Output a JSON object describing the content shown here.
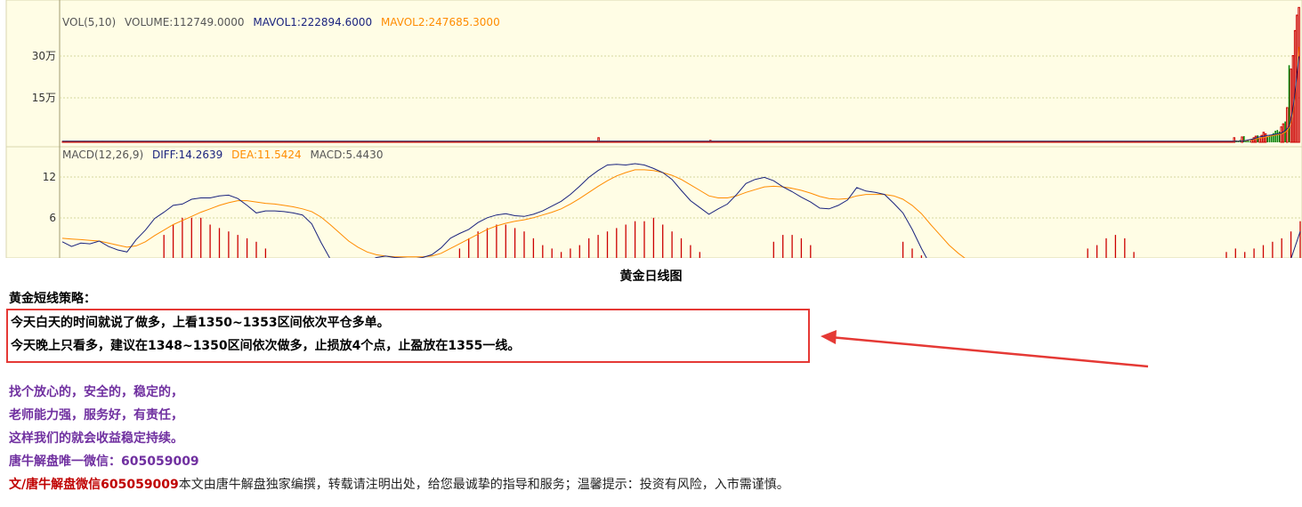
{
  "chart_data": [
    {
      "type": "bar",
      "title": "",
      "legend": [
        {
          "text": "VOL(5,10)",
          "color": "#555555"
        },
        {
          "text": "VOLUME:112749.0000",
          "color": "#555555"
        },
        {
          "text": "MAVOL1:222894.6000",
          "color": "#1a237e"
        },
        {
          "text": "MAVOL2:247685.3000",
          "color": "#ff8c00"
        }
      ],
      "ytick_labels": [
        "30万",
        "15万"
      ],
      "ytick_values": [
        300000,
        150000
      ],
      "ylim": [
        0,
        360000
      ],
      "up_color": "#cc0000",
      "down_color": "#008000",
      "volumes": [
        2000,
        1500,
        2500,
        1800,
        2200,
        1700,
        2100,
        1900,
        2300,
        1600,
        2000,
        2400,
        1800,
        2200,
        1900,
        2100,
        1700,
        2300,
        2000,
        1800,
        2500,
        2200,
        1900,
        2100,
        1800,
        2300,
        2000,
        1700,
        2200,
        2400,
        1900,
        2100,
        1800,
        2000,
        2200,
        1900,
        2300,
        1700,
        2100,
        2000,
        1800,
        2200,
        1900,
        2100,
        2300,
        2000,
        1800,
        2200,
        1900,
        2100,
        2000,
        1700,
        2300,
        2200,
        1900,
        2100,
        1800,
        2000,
        2200,
        1900,
        2100,
        2000,
        1800,
        2200,
        1900,
        2300,
        2100,
        1800,
        2000,
        2200,
        1900,
        2100,
        2000,
        1800,
        2300,
        2200,
        1900,
        2100,
        1800,
        2000,
        2200,
        1900,
        2100,
        2300,
        2000,
        1800,
        2200,
        1900,
        2100,
        2000,
        1800,
        2200,
        1900,
        2300,
        2100,
        1800,
        2000,
        2200,
        1900,
        2100,
        2000,
        1800,
        2300,
        2200,
        1900,
        2100,
        1800,
        2000,
        2200,
        1900,
        2100,
        2300,
        2000,
        1800,
        2200,
        1900,
        2100,
        2000,
        1800,
        2200,
        1900,
        2300,
        2100,
        1800,
        2000,
        2200,
        1900,
        2100,
        2000,
        1800,
        2300,
        2200,
        1900,
        2100,
        1800,
        2000,
        2200,
        1900,
        2100,
        2300,
        2000,
        1800,
        2200,
        1900,
        2100,
        2000,
        1800,
        2200,
        1900,
        2300,
        2100,
        1800,
        2000,
        2200,
        1900,
        2100,
        2000,
        1800,
        2300,
        2200,
        1900,
        2100,
        1800,
        2000,
        2200,
        1900,
        2100,
        2300,
        2000,
        1800,
        2200,
        1900,
        2100,
        2000,
        1800,
        2200,
        1900,
        2300,
        2100,
        1800,
        2000,
        2200,
        1900,
        2100,
        2000,
        1800,
        2300,
        2200,
        1900,
        2100,
        1800,
        2000,
        2200,
        1900,
        2100,
        2300,
        2000,
        1800,
        2200,
        1900,
        2100,
        2000,
        1800,
        2200,
        1900,
        2300,
        2100,
        1800,
        2000,
        2200,
        1900,
        2100,
        2000,
        1800,
        2300,
        2200,
        1900,
        2100,
        1800,
        2000,
        2200,
        1900,
        2100,
        2300,
        2000,
        1800,
        2200,
        1900,
        2100,
        2000,
        1800,
        2200,
        1900,
        2300,
        2100,
        1800,
        2000,
        2200,
        1900,
        2100,
        2000,
        1800,
        2300,
        2200,
        1900,
        2100,
        1800,
        2000,
        2200,
        1900,
        2100,
        2300,
        2000,
        1800,
        2200,
        1900,
        2100,
        2000,
        1800,
        2200,
        1900,
        2300,
        2100,
        1800,
        2000,
        2200,
        1900,
        2100,
        2000,
        1800,
        2300,
        2200,
        1900,
        12000,
        2100,
        1800,
        2000,
        2200,
        1900,
        2100,
        2300,
        2000,
        1800,
        2200,
        1900,
        2100,
        2000,
        1800,
        2200,
        1900,
        2300,
        2100,
        1800,
        2000,
        2200,
        1900,
        2100,
        2000,
        1800,
        2300,
        2200,
        1900,
        2100,
        1800,
        2000,
        2200,
        1900,
        2100,
        2300,
        2000,
        1800,
        2200,
        1900,
        2100,
        2000,
        1800,
        2200,
        1900,
        2300,
        2100,
        1800,
        2000,
        2200,
        1900,
        2100,
        2000,
        1800,
        2300,
        2200,
        1900,
        5000,
        2100,
        1800,
        2000,
        2200,
        1900,
        2100,
        2300,
        2000,
        1800,
        2200,
        1900,
        2100,
        2000,
        1800,
        2200,
        1900,
        2300,
        2100,
        1800,
        2000,
        2200,
        1900,
        2100,
        2000,
        1800,
        2300,
        2200,
        1900,
        2100,
        1800,
        2000,
        2200,
        1900,
        2100,
        2300,
        2000,
        1800,
        2200,
        1900,
        2100,
        2000,
        1800,
        2200,
        1900,
        2300,
        2100,
        1800,
        2000,
        2200,
        1900,
        2100,
        2000,
        1800,
        2300,
        2200,
        1900,
        2100,
        1800,
        2000,
        2200,
        1900,
        2100,
        2300,
        2000,
        1800,
        2200,
        1900,
        2100,
        2000,
        1800,
        2200,
        1900,
        2300,
        2100,
        1800,
        2000,
        2200,
        1900,
        2100,
        2000,
        1800,
        2300,
        2200,
        1900,
        2100,
        1800,
        2000,
        2200,
        1900,
        2100,
        2300,
        2000,
        1800,
        2200,
        1900,
        2100,
        2000,
        1800,
        2200,
        1900,
        2300,
        2100,
        1800,
        2000,
        2200,
        1900,
        2100,
        2000,
        1800,
        2300,
        2200,
        1900,
        2100,
        1800,
        2000,
        2200,
        1900,
        2100,
        2300,
        2000,
        1800,
        2200,
        1900,
        2100,
        2000,
        1800,
        2200,
        1900,
        2300,
        2100,
        1800,
        2000,
        2200,
        1900,
        2100,
        2000,
        1800,
        2300,
        2200,
        1900,
        2100,
        1800,
        2000,
        2200,
        1900,
        2100,
        2300,
        2000,
        1800,
        2200,
        1900,
        2100,
        2000,
        1800,
        2200,
        1900,
        2300,
        2100,
        1800,
        2000,
        2200,
        1900,
        2100,
        2000,
        1800,
        2300,
        2200,
        1900,
        2100,
        1800,
        2000,
        2200,
        1900,
        2100,
        2300,
        2000,
        1800,
        2200,
        1900,
        2100,
        2000,
        1800,
        2200,
        1900,
        2300,
        2100,
        1800,
        2000,
        2200,
        1900,
        2100,
        2000,
        1800,
        2300,
        2200,
        1900,
        2100,
        1800,
        2000,
        2200,
        1900,
        2100,
        2300,
        2000,
        1800,
        2200,
        1900,
        2100,
        2000,
        1800,
        2200,
        1900,
        2300,
        2100,
        1800,
        2000,
        2200,
        1900,
        2100,
        2000,
        1800,
        2300,
        2200,
        1900,
        2100,
        1800,
        2000,
        2200,
        1900,
        2100,
        2300,
        2000,
        1800,
        2200,
        1900,
        2100,
        2000,
        1800,
        2200,
        1900,
        2300,
        2100,
        1800,
        2000,
        2200,
        1900,
        2100,
        2000,
        1800,
        2300,
        2200,
        1900,
        2100,
        1800,
        2000,
        2200,
        1900,
        2100,
        2300,
        2000,
        1800,
        2200,
        1900,
        2100,
        2000,
        1800
      ],
      "recent_volumes": [
        12000,
        -5000,
        -4000,
        -6000,
        14000,
        -16000,
        -4000,
        -5000,
        -3000,
        6000,
        12000,
        16000,
        -18000,
        10000,
        18000,
        26000,
        22000,
        -15000,
        -18000,
        -20000,
        -24000,
        -30000,
        -32000,
        -28000,
        40000,
        48000,
        -54000,
        90000,
        -200000,
        190000,
        225000,
        290000,
        330000,
        350000
      ],
      "mavol1": [
        3000,
        3000,
        3000,
        3000,
        3500,
        5000,
        6000,
        7000,
        8000,
        9000,
        11000,
        13000,
        14000,
        15000,
        16000,
        17000,
        18000,
        18500,
        19000,
        20000,
        21000,
        22000,
        23000,
        24000,
        27000,
        31000,
        35000,
        42000,
        60000,
        90000,
        130000,
        180000,
        222894
      ],
      "mavol2": [
        3000,
        3000,
        3000,
        3000,
        3200,
        3800,
        4500,
        5200,
        6000,
        6800,
        7600,
        8500,
        9500,
        10500,
        11500,
        12500,
        13500,
        14500,
        15500,
        16500,
        17500,
        18500,
        19500,
        20500,
        22000,
        24000,
        26000,
        30000,
        38000,
        52000,
        80000,
        120000,
        180000,
        247685
      ]
    },
    {
      "type": "line",
      "title": "",
      "legend": [
        {
          "text": "MACD(12,26,9)",
          "color": "#555555"
        },
        {
          "text": "DIFF:14.2639",
          "color": "#1a237e"
        },
        {
          "text": "DEA:11.5424",
          "color": "#ff8c00"
        },
        {
          "text": "MACD:5.4430",
          "color": "#555555"
        }
      ],
      "ytick_labels": [
        "12",
        "6"
      ],
      "ytick_values": [
        12,
        6
      ],
      "ylim": [
        0,
        15
      ],
      "diff": [
        2.5,
        1.8,
        2.3,
        2.2,
        2.6,
        1.8,
        1.3,
        1.0,
        2.8,
        4.2,
        5.9,
        6.8,
        7.8,
        8.0,
        8.7,
        8.9,
        8.9,
        9.2,
        9.3,
        8.8,
        7.8,
        6.7,
        7.0,
        7.0,
        6.9,
        6.7,
        6.4,
        5.1,
        2.4,
        0.0,
        -1.0,
        -1.5,
        -0.8,
        -0.4,
        0.2,
        0.4,
        0.2,
        0.1,
        0.0,
        0.2,
        0.6,
        1.6,
        3.0,
        3.7,
        4.3,
        5.3,
        6.0,
        6.4,
        6.6,
        6.3,
        6.2,
        6.5,
        7.0,
        7.7,
        8.4,
        9.4,
        10.6,
        11.9,
        12.9,
        13.7,
        13.8,
        13.7,
        13.9,
        13.7,
        13.2,
        12.6,
        11.6,
        10.0,
        8.5,
        7.5,
        6.5,
        7.3,
        8.0,
        9.4,
        11.0,
        11.6,
        11.9,
        11.4,
        10.5,
        9.8,
        9.0,
        8.3,
        7.4,
        7.3,
        7.8,
        8.6,
        10.4,
        9.9,
        9.7,
        9.4,
        8.1,
        6.7,
        4.3,
        1.5,
        -1.0,
        -2.5,
        -3.0,
        -3.0,
        -3.0,
        -3.0,
        -3.0,
        -3.0,
        -3.0,
        -3.0,
        -3.0,
        -3.0,
        -3.0,
        -3.0,
        -3.0,
        -3.0,
        -3.0,
        -3.0,
        -3.0,
        -3.0,
        -3.0,
        -3.0,
        -3.0,
        -3.0,
        -3.0,
        -3.0,
        -3.0,
        -3.0,
        -3.0,
        -3.0,
        -3.0,
        -3.0,
        -3.0,
        -3.0,
        -3.0,
        -3.0,
        -3.0,
        -3.0,
        -2.0,
        0.0,
        4.0
      ],
      "dea": [
        3.0,
        2.9,
        2.8,
        2.7,
        2.6,
        2.3,
        2.0,
        1.7,
        1.9,
        2.5,
        3.4,
        4.2,
        5.0,
        5.6,
        6.2,
        6.8,
        7.3,
        7.8,
        8.2,
        8.5,
        8.5,
        8.3,
        8.1,
        8.0,
        7.8,
        7.6,
        7.3,
        6.9,
        6.1,
        5.0,
        3.8,
        2.6,
        1.7,
        1.0,
        0.6,
        0.4,
        0.3,
        0.3,
        0.3,
        0.3,
        0.4,
        0.8,
        1.5,
        2.2,
        2.9,
        3.6,
        4.3,
        4.8,
        5.2,
        5.5,
        5.7,
        6.0,
        6.4,
        6.8,
        7.3,
        8.0,
        8.8,
        9.7,
        10.6,
        11.4,
        12.1,
        12.6,
        13.0,
        13.0,
        12.9,
        12.6,
        12.2,
        11.6,
        10.8,
        10.0,
        9.2,
        8.9,
        8.9,
        9.2,
        9.7,
        10.1,
        10.5,
        10.6,
        10.5,
        10.3,
        10.0,
        9.6,
        9.1,
        8.8,
        8.7,
        8.8,
        9.2,
        9.4,
        9.4,
        9.4,
        9.2,
        8.7,
        7.8,
        6.6,
        5.0,
        3.5,
        2.0,
        0.8,
        -0.2,
        -1.0,
        -1.6,
        -2.0,
        -2.3,
        -2.5,
        -2.6,
        -2.7,
        -2.8,
        -2.8,
        -2.8,
        -2.8,
        -2.8,
        -2.8,
        -2.8,
        -2.8,
        -2.8,
        -2.8,
        -2.8,
        -2.8,
        -2.8,
        -2.8,
        -2.8,
        -2.8,
        -2.8,
        -2.8,
        -2.8,
        -2.8,
        -2.8,
        -2.8,
        -2.8,
        -2.8,
        -2.8,
        -2.8,
        -2.6,
        -2.0,
        -0.5
      ],
      "macd_bars": [
        0,
        0,
        0,
        0,
        0,
        0,
        0,
        0,
        0,
        0,
        0,
        3.5,
        5.0,
        6.0,
        6.0,
        6.0,
        5.0,
        4.5,
        4.0,
        3.5,
        3.0,
        2.5,
        1.5,
        0,
        0,
        0,
        0,
        0,
        0,
        0,
        0,
        0,
        0,
        0,
        0,
        0,
        0,
        0,
        0,
        0,
        0,
        0,
        0,
        1.5,
        3.0,
        4.0,
        4.5,
        5.0,
        5.0,
        4.5,
        4.0,
        3.0,
        2.0,
        1.5,
        1.0,
        1.5,
        2.0,
        3.0,
        3.5,
        4.0,
        4.5,
        5.0,
        5.5,
        5.5,
        6.0,
        5.0,
        4.0,
        3.0,
        2.0,
        1.0,
        0,
        0,
        0,
        0,
        0,
        0,
        0,
        2.5,
        3.5,
        3.5,
        3.0,
        2.0,
        0,
        0,
        0,
        0,
        0,
        0,
        0,
        0,
        0,
        2.5,
        1.5,
        0.5,
        0,
        0,
        0,
        0,
        0,
        0,
        0,
        0,
        0,
        0,
        0,
        0,
        0,
        0,
        0,
        0,
        0,
        1.5,
        2.0,
        3.0,
        3.5,
        3.0,
        1.0,
        0,
        0,
        0,
        0,
        0,
        0,
        0,
        0,
        0,
        1.0,
        1.5,
        1.0,
        1.5,
        2.0,
        2.5,
        3.0,
        4.0,
        5.5,
        6.0,
        6.0,
        4.5,
        3.0,
        2.0,
        1.0,
        0,
        0,
        0,
        0,
        0,
        0,
        0,
        0,
        3.5,
        7.5
      ]
    }
  ],
  "page": {
    "chart_caption": "黄金日线图",
    "strategy_heading": "黄金短线策略：",
    "strategy_line1": "今天白天的时间就说了做多，上看1350~1353区间依次平仓多单。",
    "strategy_line2": "今天晚上只看多，建议在1348~1350区间依次做多，止损放4个点，止盈放在1355一线。",
    "purple_line1": "找个放心的，安全的，稳定的，",
    "purple_line2": "老师能力强，服务好，有责任，",
    "purple_line3": "这样我们的就会收益稳定持续。",
    "purple_line4": "唐牛解盘唯一微信：605059009",
    "footer_strong": "文/唐牛解盘微信605059009",
    "footer_rest": "本文由唐牛解盘独家编撰，转载请注明出处，给您最诚挚的指导和服务；温馨提示：投资有风险，入市需谨慎。"
  },
  "colors": {
    "panel_bg": "#fffde5",
    "border": "#d9d6b0",
    "grid": "#d6d6a0",
    "diff": "#1a237e",
    "dea": "#ff8c00",
    "macd_bar": "#cc0000",
    "arrow": "#e53935"
  }
}
